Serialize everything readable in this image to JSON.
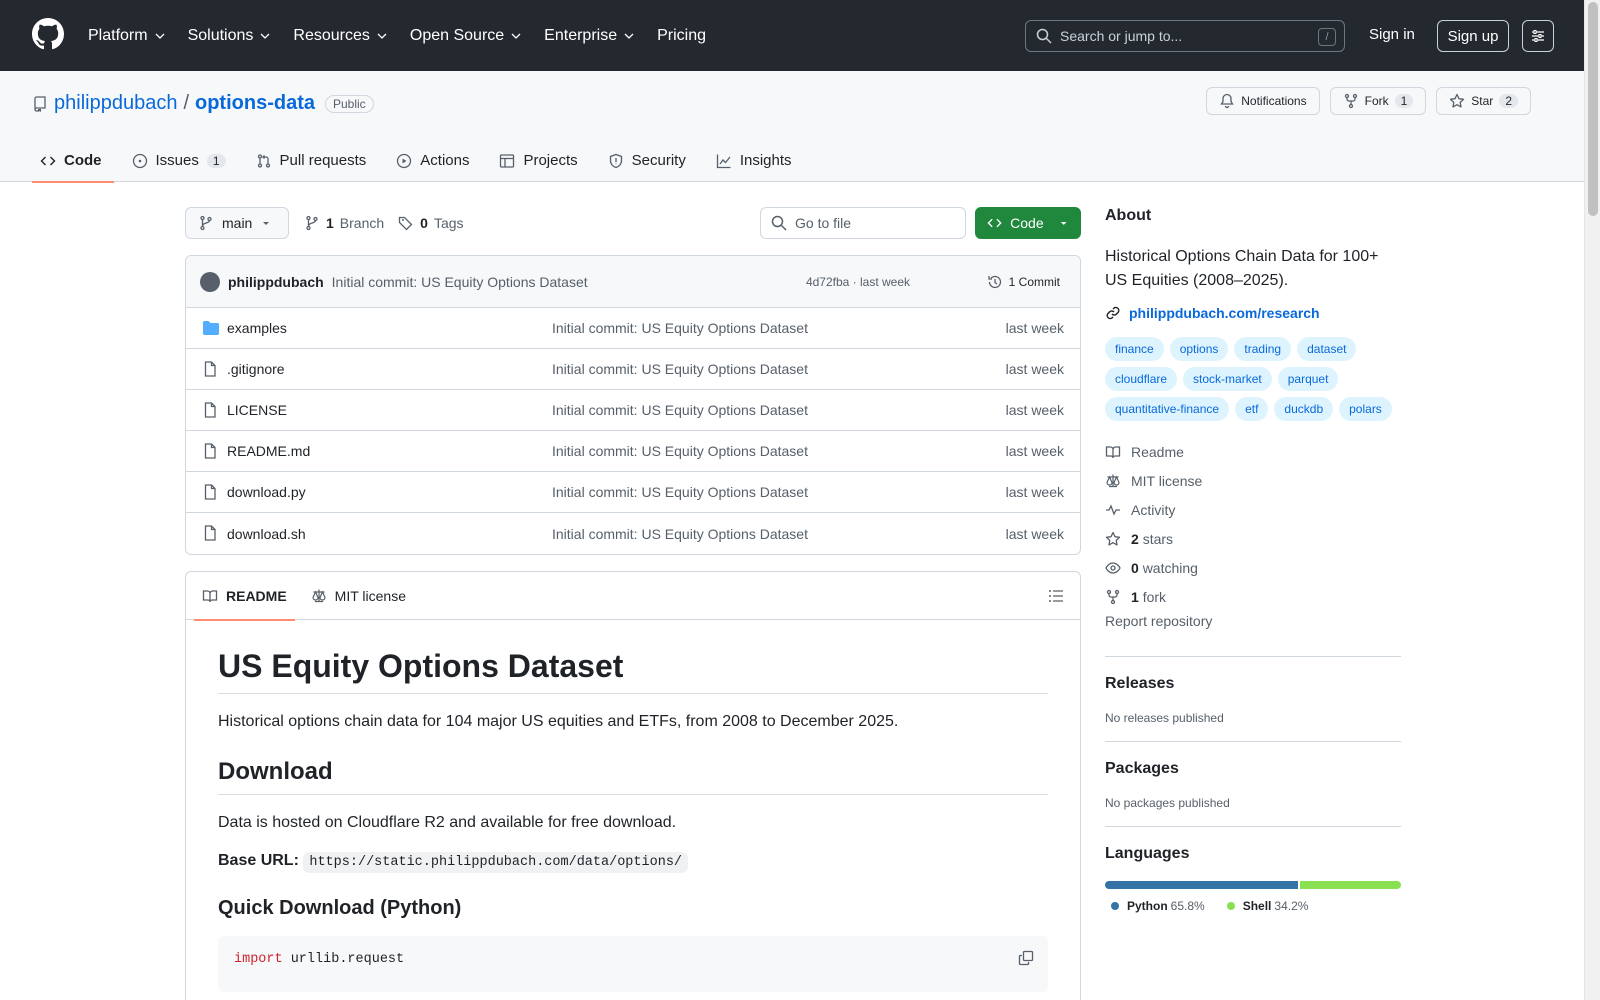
{
  "header": {
    "nav": [
      "Platform",
      "Solutions",
      "Resources",
      "Open Source",
      "Enterprise",
      "Pricing"
    ],
    "search_placeholder": "Search or jump to...",
    "search_key": "/",
    "sign_in": "Sign in",
    "sign_up": "Sign up"
  },
  "repo": {
    "owner": "philippdubach",
    "separator": "/",
    "name": "options-data",
    "visibility": "Public",
    "notifications_label": "Notifications",
    "fork_label": "Fork",
    "fork_count": "1",
    "star_label": "Star",
    "star_count": "2",
    "tabs": [
      {
        "label": "Code",
        "count": ""
      },
      {
        "label": "Issues",
        "count": "1"
      },
      {
        "label": "Pull requests",
        "count": ""
      },
      {
        "label": "Actions",
        "count": ""
      },
      {
        "label": "Projects",
        "count": ""
      },
      {
        "label": "Security",
        "count": ""
      },
      {
        "label": "Insights",
        "count": ""
      }
    ]
  },
  "toolbar": {
    "branch": "main",
    "branch_count": "1",
    "branch_label": "Branch",
    "tag_count": "0",
    "tag_label": "Tags",
    "goto_placeholder": "Go to file",
    "code_button": "Code"
  },
  "commit": {
    "author": "philippdubach",
    "message": "Initial commit: US Equity Options Dataset",
    "meta": "4d72fba · last week",
    "count_label": "1 Commit"
  },
  "files": [
    {
      "name": "examples",
      "type": "folder",
      "commit": "Initial commit: US Equity Options Dataset",
      "time": "last week"
    },
    {
      "name": ".gitignore",
      "type": "file",
      "commit": "Initial commit: US Equity Options Dataset",
      "time": "last week"
    },
    {
      "name": "LICENSE",
      "type": "file",
      "commit": "Initial commit: US Equity Options Dataset",
      "time": "last week"
    },
    {
      "name": "README.md",
      "type": "file",
      "commit": "Initial commit: US Equity Options Dataset",
      "time": "last week"
    },
    {
      "name": "download.py",
      "type": "file",
      "commit": "Initial commit: US Equity Options Dataset",
      "time": "last week"
    },
    {
      "name": "download.sh",
      "type": "file",
      "commit": "Initial commit: US Equity Options Dataset",
      "time": "last week"
    }
  ],
  "readme": {
    "tab_readme": "README",
    "tab_license": "MIT license",
    "h1": "US Equity Options Dataset",
    "intro": "Historical options chain data for 104 major US equities and ETFs, from 2008 to December 2025.",
    "h2_download": "Download",
    "download_text": "Data is hosted on Cloudflare R2 and available for free download.",
    "base_url_label": "Base URL:",
    "base_url": "https://static.philippdubach.com/data/options/",
    "h3_quick": "Quick Download (Python)",
    "code_keyword": "import",
    "code_rest": " urllib.request"
  },
  "about": {
    "heading": "About",
    "description": "Historical Options Chain Data for 100+ US Equities (2008–2025).",
    "link": "philippdubach.com/research",
    "topics": [
      "finance",
      "options",
      "trading",
      "dataset",
      "cloudflare",
      "stock-market",
      "parquet",
      "quantitative-finance",
      "etf",
      "duckdb",
      "polars"
    ],
    "readme": "Readme",
    "license": "MIT license",
    "activity": "Activity",
    "stars_count": "2",
    "stars_label": "stars",
    "watching_count": "0",
    "watching_label": "watching",
    "forks_count": "1",
    "forks_label": "fork",
    "report": "Report repository"
  },
  "releases": {
    "heading": "Releases",
    "text": "No releases published"
  },
  "packages": {
    "heading": "Packages",
    "text": "No packages published"
  },
  "languages": {
    "heading": "Languages",
    "items": [
      {
        "name": "Python",
        "percent": "65.8%",
        "value": 65.8,
        "color": "#3572A5"
      },
      {
        "name": "Shell",
        "percent": "34.2%",
        "value": 34.2,
        "color": "#89e051"
      }
    ]
  }
}
